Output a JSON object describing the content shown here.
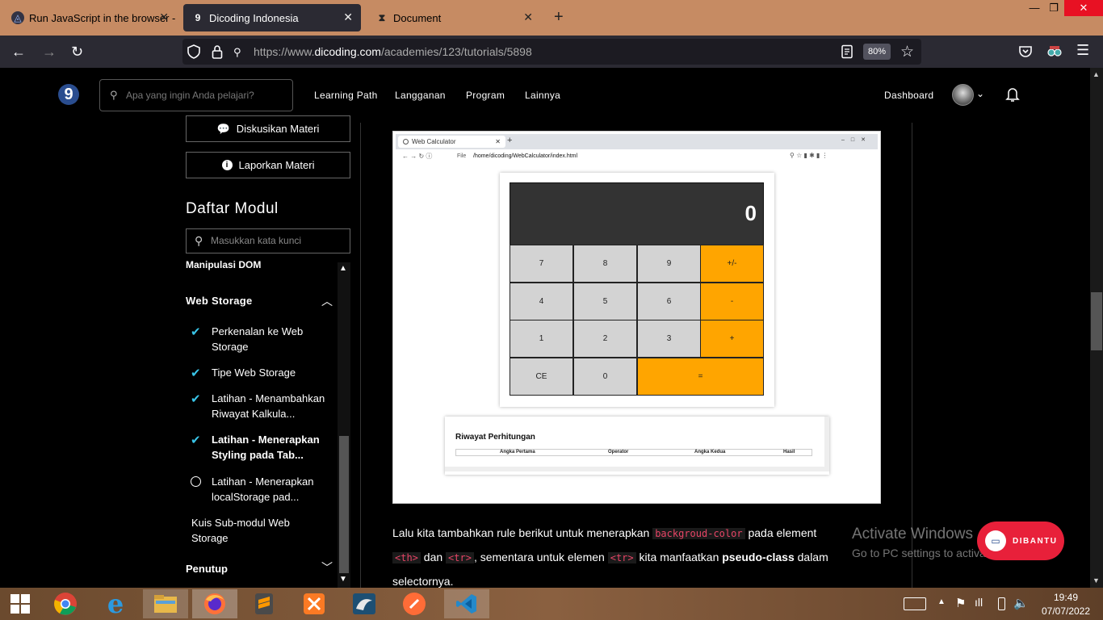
{
  "browser": {
    "tabs": [
      {
        "label": "Run JavaScript in the browser -"
      },
      {
        "label": "Dicoding Indonesia"
      },
      {
        "label": "Document"
      }
    ],
    "new_tab": "+",
    "url_prefix": "https://www.",
    "url_domain": "dicoding.com",
    "url_path": "/academies/123/tutorials/5898",
    "zoom": "80%"
  },
  "site": {
    "logo": "9",
    "search_placeholder": "Apa yang ingin Anda pelajari?",
    "menu": [
      "Learning Path",
      "Langganan",
      "Program",
      "Lainnya"
    ],
    "dashboard": "Dashboard"
  },
  "sidebar": {
    "btn_diskusi": "Diskusikan Materi",
    "btn_lapor": "Laporkan Materi",
    "title": "Daftar Modul",
    "search_placeholder": "Masukkan kata kunci",
    "prev_section": "Manipulasi DOM",
    "section": "Web Storage",
    "items": [
      {
        "label": "Perkenalan ke Web Storage",
        "status": "done"
      },
      {
        "label": "Tipe Web Storage",
        "status": "done"
      },
      {
        "label": "Latihan - Menambahkan Riwayat Kalkula...",
        "status": "done"
      },
      {
        "label": "Latihan - Menerapkan Styling pada Tab...",
        "status": "current"
      },
      {
        "label": "Latihan - Menerapkan localStorage pad...",
        "status": "todo"
      }
    ],
    "quiz": "Kuis Sub-modul Web Storage",
    "next_section": "Penutup"
  },
  "screenshot": {
    "tab": "Web Calculator",
    "file_label": "File",
    "path": "/home/dicoding/WebCalculator/index.html",
    "display": "0",
    "keys": [
      "7",
      "8",
      "9",
      "+/-",
      "4",
      "5",
      "6",
      "-",
      "1",
      "2",
      "3",
      "+",
      "CE",
      "0",
      "="
    ],
    "history_title": "Riwayat Perhitungan",
    "history_headers": [
      "Angka Pertama",
      "Operator",
      "Angka Kedua",
      "Hasil"
    ]
  },
  "article": {
    "t1": "Lalu kita tambahkan rule berikut untuk menerapkan ",
    "c1": "backgroud-color",
    "t2": " pada element",
    "c2": "<th>",
    "t3": " dan ",
    "c3": "<tr>",
    "t4": ", sementara untuk elemen ",
    "c4": "<tr>",
    "t5": " kita manfaatkan ",
    "b1": "pseudo-class",
    "t6": " dalam",
    "t7": "selectornya."
  },
  "watermark": {
    "title": "Activate Windows",
    "sub": "Go to PC settings to activate Windows."
  },
  "help_button": "DIBANTU",
  "taskbar": {
    "time": "19:49",
    "date": "07/07/2022"
  },
  "colors": {
    "accent_check": "#39c5e8",
    "calc_op": "#ffa500",
    "code": "#e74566"
  }
}
